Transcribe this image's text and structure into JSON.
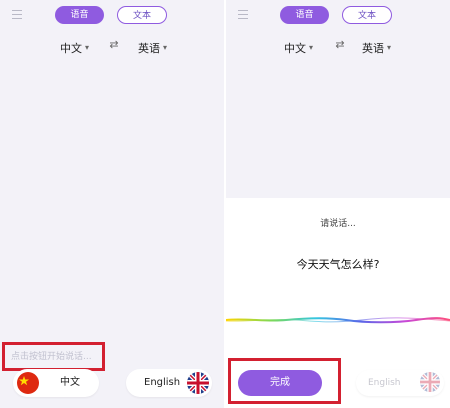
{
  "left": {
    "tabs": {
      "voice": "语音",
      "text": "文本"
    },
    "lang_bar": {
      "from": "中文",
      "to": "英语"
    },
    "input_placeholder": "点击按钮开始说话...",
    "bottom": {
      "chinese_label": "中文",
      "english_label": "English"
    }
  },
  "right": {
    "tabs": {
      "voice": "语音",
      "text": "文本"
    },
    "lang_bar": {
      "from": "中文",
      "to": "英语"
    },
    "speak_prompt": "请说话...",
    "recognized_text": "今天天气怎么样?",
    "done_button": "完成",
    "english_label": "English"
  },
  "colors": {
    "accent": "#8f5be0",
    "highlight": "#d32030",
    "panel_bg": "#f3f2f8"
  },
  "icons": [
    "menu-icon",
    "chevron-down-icon",
    "swap-icon",
    "china-flag-icon",
    "uk-flag-icon"
  ]
}
